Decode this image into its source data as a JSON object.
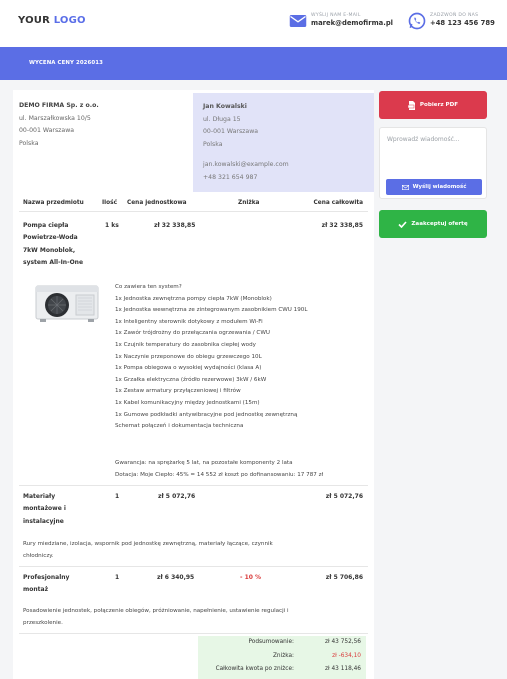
{
  "header": {
    "logo_prefix": "YOUR",
    "logo_suffix": "LOGO",
    "email_caption": "WYŚLIJ NAM E-MAIL",
    "email": "marek@demofirma.pl",
    "phone_caption": "ZADZWOŃ DO NAS",
    "phone": "+48 123 456 789",
    "icons": [
      "mail-icon",
      "whatsapp-icon"
    ]
  },
  "banner": {
    "title": "WYCENA CENY 2026013"
  },
  "seller": {
    "name": "DEMO FIRMA Sp. z o.o.",
    "street": "ul. Marszałkowska 10/5",
    "city": "00-001 Warszawa",
    "country": "Polska"
  },
  "buyer": {
    "name": "Jan Kowalski",
    "street": "ul. Długa 15",
    "city": "00-001 Warszawa",
    "country": "Polska",
    "email": "jan.kowalski@example.com",
    "phone": "+48 321 654 987"
  },
  "table": {
    "headers": {
      "name": "Nazwa przedmiotu",
      "qty": "Ilość",
      "unit_price": "Cena jednostkowa",
      "discount": "Zniżka",
      "total": "Cena całkowita"
    },
    "items": [
      {
        "name_lines": [
          "Pompa ciepła",
          "Powietrze-Woda",
          "7kW Monoblok,",
          "system All-In-One"
        ],
        "qty": "1 ks",
        "unit_price": "zł 32 338,85",
        "discount": "",
        "total": "zł 32 338,85",
        "description_lines": [
          "Co zawiera ten system?",
          "1x Jednostka zewnętrzna pompy ciepła 7kW (Monoblok)",
          "1x Jednostka wewnętrzna ze zintegrowanym zasobnikiem CWU 190L",
          "1x Inteligentny sterownik dotykowy z modułem Wi-Fi",
          "1x Zawór trójdrożny do przełączania ogrzewania / CWU",
          "1x Czujnik temperatury do zasobnika ciepłej wody",
          "1x Naczynie przeponowe do obiegu grzewczego 10L",
          "1x Pompa obiegowa o wysokiej wydajności (klasa A)",
          "1x Grzałka elektryczna (źródło rezerwowe) 3kW / 6kW",
          "1x Zestaw armatury przyłączeniowej i filtrów",
          "1x Kabel komunikacyjny między jednostkami (15m)",
          "1x Gumowe podkładki antywibracyjne pod jednostkę zewnętrzną",
          "Schemat połączeń i dokumentacja techniczna"
        ],
        "notes": [
          "Gwarancja: na sprężarkę 5 lat, na pozostałe komponenty 2 lata",
          "Dotacja: Moje Ciepło: 45% = 14 552 zł koszt po dofinansowaniu: 17 787 zł"
        ]
      },
      {
        "name_lines": [
          "Materiały",
          "montażowe i",
          "instalacyjne"
        ],
        "qty": "1",
        "unit_price": "zł 5 072,76",
        "discount": "",
        "total": "zł 5 072,76",
        "description_lines": [
          "Rury miedziane, izolacja, wspornik pod jednostkę zewnętrzną, materiały łączące, czynnik",
          "chłodniczy."
        ]
      },
      {
        "name_lines": [
          "Profesjonalny",
          "montaż"
        ],
        "qty": "1",
        "unit_price": "zł 6 340,95",
        "discount": "- 10 %",
        "total": "zł 5 706,86",
        "description_lines": [
          "Posadowienie jednostek, połączenie obiegów, próżniowanie, napełnienie, ustawienie regulacji i",
          "przeszkolenie."
        ]
      }
    ]
  },
  "summary": {
    "subtotal_label": "Podsumowanie:",
    "subtotal": "zł 43 752,56",
    "discount_label": "Zniżka:",
    "discount": "zł -634,10",
    "total_label": "Całkowita kwota po zniżce:",
    "total": "zł 43 118,46"
  },
  "sidebar": {
    "pdf_button": "Pobierz PDF",
    "message_placeholder": "Wprowadź wiadomość...",
    "send_button": "Wyślij wiadomość",
    "accept_button": "Zaakceptuj ofertę"
  },
  "colors": {
    "brand": "#5b6ee5",
    "pdf_button": "#db3a4d",
    "accept_button": "#2fb446",
    "buyer_bg": "#e1e3f8",
    "summary_bg": "#e7f7e6"
  }
}
